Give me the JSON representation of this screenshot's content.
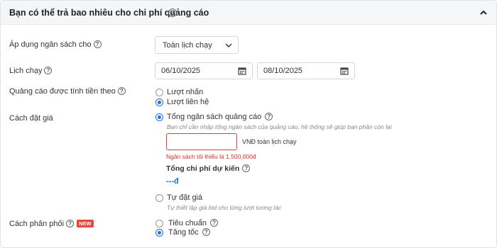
{
  "header": {
    "title": "Bạn có thể trả bao nhiêu cho chi phí quảng cáo",
    "help_icon": "question-circle-icon",
    "collapse_icon": "chevron-up-icon"
  },
  "budget_scope": {
    "label": "Áp dụng ngân sách cho",
    "selected": "Toàn lịch chạy"
  },
  "schedule": {
    "label": "Lịch chạy",
    "start_date": "06/10/2025",
    "end_date": "08/10/2025"
  },
  "billing": {
    "label": "Quảng cáo được tính tiền theo",
    "options": [
      "Lượt nhấn",
      "Lượt liên hệ"
    ],
    "selected_index": 1
  },
  "bidding": {
    "label": "Cách đặt giá",
    "total_budget": {
      "label": "Tổng ngân sách quảng cáo",
      "hint": "Bạn chỉ cần nhập tổng ngân sách của quảng cáo, hệ thống sẽ giúp bạn phần còn lại",
      "input_value": "",
      "unit": "VNĐ toàn lịch chạy",
      "error": "Ngân sách tối thiểu là 1,500,000đ",
      "estimate_label": "Tổng chi phí dự kiến",
      "estimate_value": "---đ"
    },
    "manual": {
      "label": "Tự đặt giá",
      "hint": "Tự thiết lập giá bid cho từng lượt tương tác"
    },
    "selected": "total_budget"
  },
  "delivery": {
    "label": "Cách phân phối",
    "badge": "NEW",
    "options": [
      "Tiêu chuẩn",
      "Tăng tốc"
    ],
    "selected_index": 1
  },
  "colors": {
    "accent": "#1a73e8",
    "error": "#d0312d",
    "badge": "#e8453c"
  }
}
